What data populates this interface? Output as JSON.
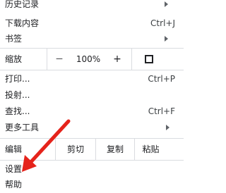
{
  "menu": {
    "history": {
      "label": "历史记录"
    },
    "downloads": {
      "label": "下载内容",
      "shortcut": "Ctrl+J"
    },
    "bookmarks": {
      "label": "书签"
    },
    "zoom": {
      "label": "缩放",
      "minus": "－",
      "value": "100%",
      "plus": "+"
    },
    "print": {
      "label": "打印...",
      "shortcut": "Ctrl+P"
    },
    "cast": {
      "label": "投射..."
    },
    "find": {
      "label": "查找...",
      "shortcut": "Ctrl+F"
    },
    "more_tools": {
      "label": "更多工具"
    },
    "edit": {
      "label": "编辑",
      "cut": "剪切",
      "copy": "复制",
      "paste": "粘贴"
    },
    "settings": {
      "label": "设置"
    },
    "help": {
      "label": "帮助"
    }
  },
  "annotation": {
    "arrow_color": "#e5231b"
  }
}
